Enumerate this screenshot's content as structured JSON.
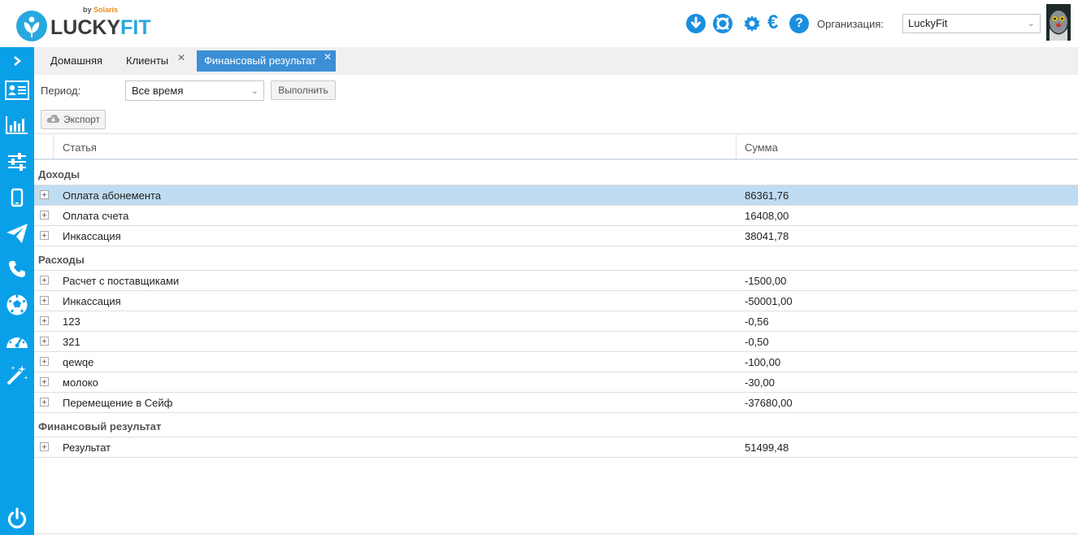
{
  "app": {
    "logo_text_main": "LUCKY",
    "logo_text_accent": "FIT",
    "logo_by": "by",
    "logo_brand": "Solaris"
  },
  "header": {
    "icons": [
      "download-icon",
      "lifebuoy-icon",
      "gear-icon",
      "euro-icon",
      "help-icon"
    ],
    "euro_symbol": "€",
    "help_symbol": "?",
    "org_label": "Организация:",
    "org_value": "LuckyFit"
  },
  "sidebar": {
    "items": [
      "chevron-right-icon",
      "contact-card-icon",
      "bar-chart-icon",
      "sliders-icon",
      "mobile-icon",
      "paper-plane-icon",
      "phone-icon",
      "soccer-ball-icon",
      "speedometer-icon",
      "magic-wand-icon",
      "power-icon"
    ]
  },
  "tabs": [
    {
      "label": "Домашняя",
      "closable": false,
      "active": false
    },
    {
      "label": "Клиенты",
      "closable": true,
      "active": false
    },
    {
      "label": "Финансовый результат",
      "closable": true,
      "active": true
    }
  ],
  "tab_close_symbol": "✕",
  "toolbar": {
    "period_label": "Период:",
    "period_value": "Все время",
    "run_label": "Выполнить",
    "export_label": "Экспорт"
  },
  "grid": {
    "columns": [
      "Статья",
      "Сумма"
    ],
    "groups": [
      {
        "title": "Доходы",
        "rows": [
          {
            "name": "Оплата абонемента",
            "sum": "86361,76",
            "selected": true
          },
          {
            "name": "Оплата счета",
            "sum": "16408,00"
          },
          {
            "name": "Инкассация",
            "sum": "38041,78"
          }
        ]
      },
      {
        "title": "Расходы",
        "rows": [
          {
            "name": "Расчет с поставщиками",
            "sum": "-1500,00"
          },
          {
            "name": "Инкассация",
            "sum": "-50001,00"
          },
          {
            "name": "123",
            "sum": "-0,56"
          },
          {
            "name": "321",
            "sum": "-0,50"
          },
          {
            "name": "qewqe",
            "sum": "-100,00"
          },
          {
            "name": "молоко",
            "sum": "-30,00"
          },
          {
            "name": "Перемещение в Сейф",
            "sum": "-37680,00"
          }
        ]
      },
      {
        "title": "Финансовый результат",
        "rows": [
          {
            "name": "Результат",
            "sum": "51499,48"
          }
        ]
      }
    ]
  },
  "colors": {
    "sidebar": "#0aa0e8",
    "accent": "#1a8fe0",
    "active_tab": "#3b8fd5",
    "selected_row": "#bfdcf2",
    "logo_orange": "#f08a1c"
  }
}
